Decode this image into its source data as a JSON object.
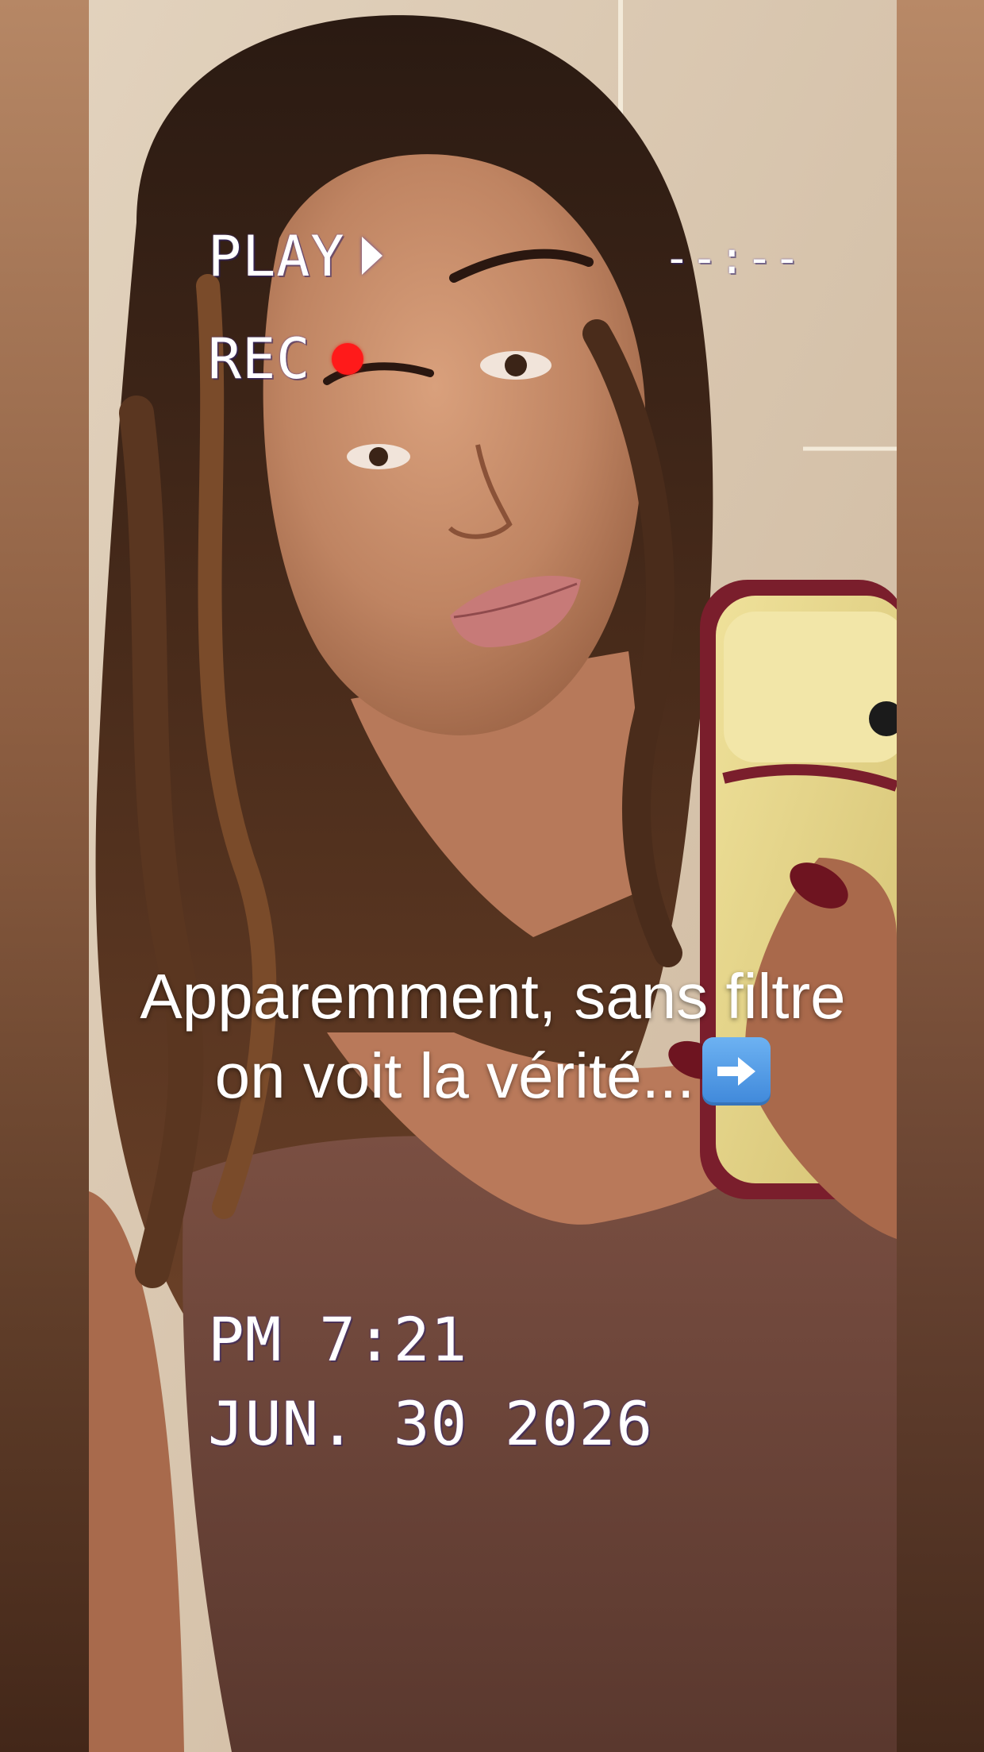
{
  "overlay": {
    "play_label": "PLAY",
    "rec_label": "REC",
    "timecode": "--:--",
    "time": "PM 7:21",
    "date": "JUN. 30 2026"
  },
  "caption": {
    "line1": "Apparemment, sans filtre",
    "line2": "on voit la vérité..."
  },
  "photo": {
    "description_icon": "selfie-photo"
  },
  "colors": {
    "rec_dot": "#ff1a1a",
    "overlay_text": "#ffffff",
    "arrow_badge": "#4a94e0"
  }
}
